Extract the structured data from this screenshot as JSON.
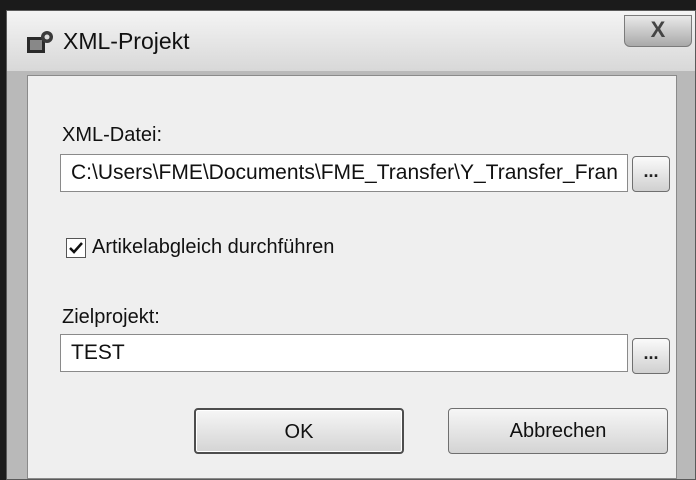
{
  "window": {
    "title": "XML-Projekt",
    "close_glyph": "X"
  },
  "xml_file": {
    "label": "XML-Datei:",
    "value": "C:\\Users\\FME\\Documents\\FME_Transfer\\Y_Transfer_Fran",
    "browse_label": "..."
  },
  "sync": {
    "label": "Artikelabgleich durchführen",
    "checked": true
  },
  "target_project": {
    "label": "Zielprojekt:",
    "value": "TEST",
    "browse_label": "..."
  },
  "buttons": {
    "ok": "OK",
    "cancel": "Abbrechen"
  },
  "icons": {
    "app": "app-gear-icon",
    "close": "close-icon",
    "check": "checkmark-icon"
  }
}
